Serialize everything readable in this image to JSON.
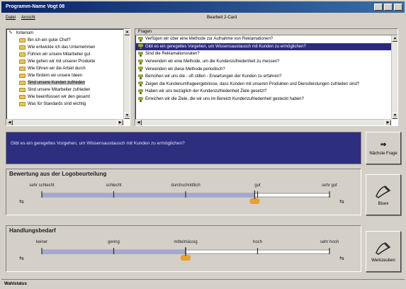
{
  "window": {
    "title": "Programm-Name Vogt 08"
  },
  "menubar": {
    "items": [
      "Datei",
      "Ansicht"
    ],
    "center_label": "Bearbeit 2-Card"
  },
  "tree": {
    "header": "",
    "root_label": "Kriterium",
    "items": [
      "Bin ich ein guter Chef?",
      "Wie entwickle ich das Unternehmen",
      "Führen wir unsere Mitarbeiter gut",
      "Wie gehen wir mit unserer Produkte",
      "Wie führen wir die Arbeit durch",
      "Wie fördern wir unsere Ideen",
      "Sind unsere Kunden zufrieden",
      "Sind unsere Mitarbeiter zufrieden",
      "Wie beeinflussen wir den gesamt",
      "Was für Standards sind wichtig"
    ],
    "selected_index": 6
  },
  "questions": {
    "header": "Fragen",
    "items": [
      "Verfügen wir über eine Methode zur Aufnahme von Reklamationen?",
      "Gibt es ein geregeltes Vorgehen, um Wissensaustausch mit Kunden zu ermöglichen?",
      "Sind die Reklamationsraten?",
      "Verwenden wir eine Methode, um die Kundenzufriedenheit zu messen?",
      "Verwenden wir diese Methode periodisch?",
      "Bemühen wir uns die - oft stillen - Erwartungen der Kunden zu erfahren?",
      "Zeigen die Kundenumfrageergebnisse, dass Kunden mit unseren Produkten und Dienstleistungen zufrieden sind?",
      "Haben wir uns bezüglich der Kundenzufriedenheit Ziele gesetzt?",
      "Erreichen wir die Ziele, die wir uns im Bereich Kundenzufriedenheit gesteckt haben?"
    ],
    "selected_index": 1
  },
  "current_question": "Gibt es ein geregeltes Vorgehen, um Wissensaustausch mit Kunden zu ermöglichen?",
  "next_button": {
    "glyph": "⇒",
    "label": "Nächste Frage"
  },
  "evaluation": {
    "title": "Bewertung aus der Logobeurteilung",
    "labels": [
      "sehr schlecht",
      "schlecht",
      "durchschnittlich",
      "gut",
      "sehr gut"
    ],
    "value": 0.74,
    "button_label": "Bisex"
  },
  "action": {
    "title": "Handlungsbedarf",
    "labels": [
      "keiner",
      "gering",
      "mittelmässig",
      "hoch",
      "sehr hoch"
    ],
    "value": 0.5,
    "button_label": "Werkzeuben"
  },
  "status": {
    "text": "Wahlstatus"
  },
  "colors": {
    "selection": "#2a2a80",
    "question_bg": "#2e2e7e",
    "marker": "#e8a030",
    "bar_fill": "#a0a8d8"
  },
  "icons": {
    "question": "question-icon",
    "folder": "folder-icon",
    "pen": "pen-icon"
  }
}
